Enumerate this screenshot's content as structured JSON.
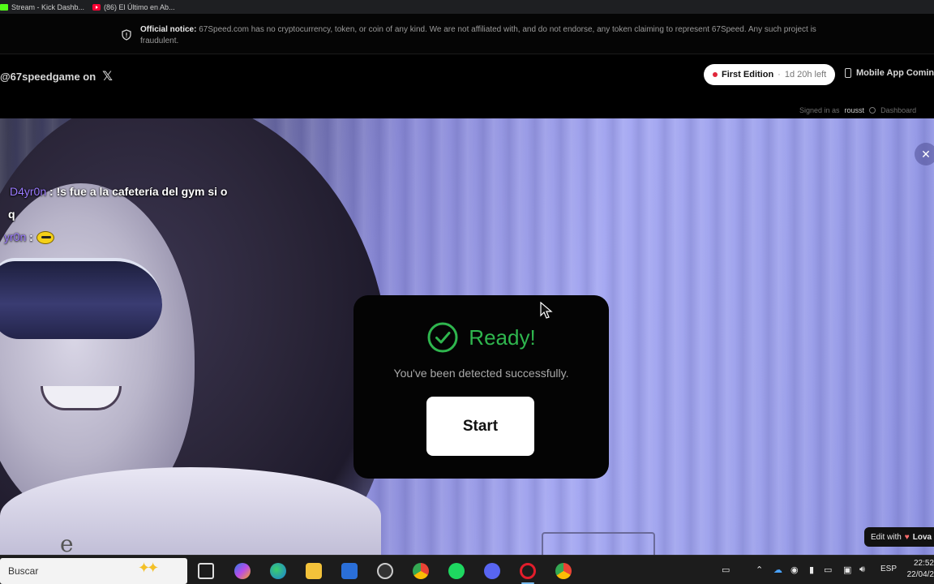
{
  "browser": {
    "tabs": [
      {
        "title": "Stream - Kick Dashb...",
        "icon": "kick-favicon"
      },
      {
        "title": "(86) El Último en Ab...",
        "icon": "youtube-favicon"
      }
    ]
  },
  "notice": {
    "label": "Official notice:",
    "text": "67Speed.com has no cryptocurrency, token, or coin of any kind. We are not affiliated with, and do not endorse, any token claiming to represent 67Speed. Any such project is fraudulent.",
    "icon": "shield-icon"
  },
  "header": {
    "handle": "@67speedgame on",
    "edition_label": "First Edition",
    "edition_separator": "·",
    "edition_time_left": "1d 20h left",
    "mobile_label": "Mobile App Coming",
    "signed_in_prefix": "Signed in as",
    "signed_in_user": "rousst",
    "dashboard_label": "Dashboard"
  },
  "chat": {
    "messages": [
      {
        "user": "D4yr0n",
        "separator": " : ",
        "text": "!s fue a la cafetería del gym si o",
        "continuation": "q"
      },
      {
        "user": "yr0n",
        "separator": " : ",
        "text": ""
      }
    ]
  },
  "modal": {
    "title": "Ready!",
    "subtitle": "You've been detected successfully.",
    "button": "Start",
    "accent_color": "#2fb64e"
  },
  "overlay": {
    "close_symbol": "✕",
    "edit_with": "Edit with",
    "edit_brand": "Lova"
  },
  "taskbar": {
    "search_placeholder": "Buscar",
    "language": "ESP",
    "time": "22:52",
    "date": "22/04/2"
  },
  "colors": {
    "modal_bg": "#040404",
    "edition_dot": "#e0263a",
    "chat_username": "#9b7bff"
  }
}
